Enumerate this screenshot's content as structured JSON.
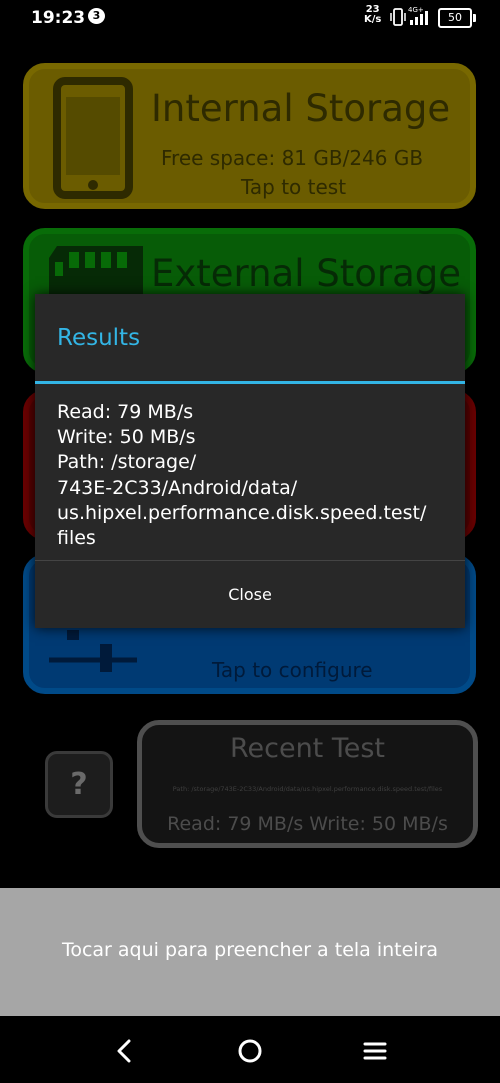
{
  "status_bar": {
    "time": "19:23",
    "notification_count": "3",
    "net_speed_value": "23",
    "net_speed_unit": "K/s",
    "network_type": "4G+",
    "battery": "50"
  },
  "cards": {
    "internal": {
      "title": "Internal Storage",
      "free_space": "Free space: 81 GB/246 GB",
      "action": "Tap to test"
    },
    "external": {
      "title": "External Storage"
    },
    "settings": {
      "action": "Tap to configure"
    }
  },
  "help": {
    "label": "?"
  },
  "recent_test": {
    "title": "Recent Test",
    "path": "Path: /storage/743E-2C33/Android/data/us.hipxel.performance.disk.speed.test/files",
    "result": "Read: 79 MB/s Write: 50 MB/s"
  },
  "dialog": {
    "title": "Results",
    "lines": [
      "Read: 79 MB/s",
      "Write: 50 MB/s",
      "Path: /storage/",
      "743E-2C33/Android/data/",
      "us.hipxel.performance.disk.speed.test/",
      "files"
    ],
    "close_label": "Close"
  },
  "banner": {
    "text": "Tocar aqui para preencher a tela inteira"
  },
  "colors": {
    "accent": "#33b5e5",
    "internal_card": "#6b5c00",
    "external_card": "#075c07",
    "red_card": "#5a0000",
    "blue_card": "#003a73"
  },
  "icons": [
    "phone-icon",
    "sd-card-icon",
    "sliders-icon",
    "back-icon",
    "home-icon",
    "menu-icon",
    "vibrate-icon",
    "signal-icon",
    "battery-icon"
  ]
}
